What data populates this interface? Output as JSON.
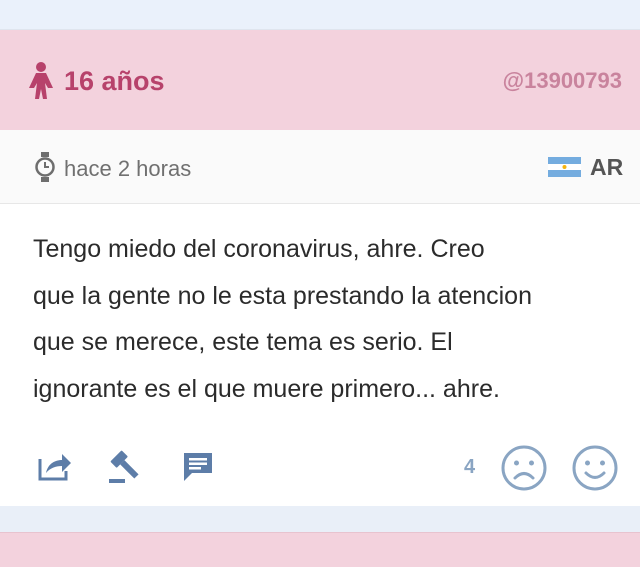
{
  "post": {
    "age": "16 años",
    "user_id": "@13900793",
    "time": "hace 2 horas",
    "country": "AR",
    "text": "Tengo miedo del coronavirus, ahre.  Creo\nque la gente no le esta prestando la atencion\nque se merece, este tema es serio. El\nignorante es el que muere primero... ahre.",
    "reaction_count": "4",
    "icons": {
      "gender": "female-icon",
      "time": "watch-icon",
      "flag": "argentina-flag-icon",
      "share": "share-icon",
      "judge": "gavel-icon",
      "comment": "comment-icon",
      "sad": "sad-face-icon",
      "happy": "happy-face-icon"
    }
  },
  "colors": {
    "header_bg": "#f3d2dd",
    "accent": "#b7426b",
    "reaction": "#8aa5c3"
  }
}
